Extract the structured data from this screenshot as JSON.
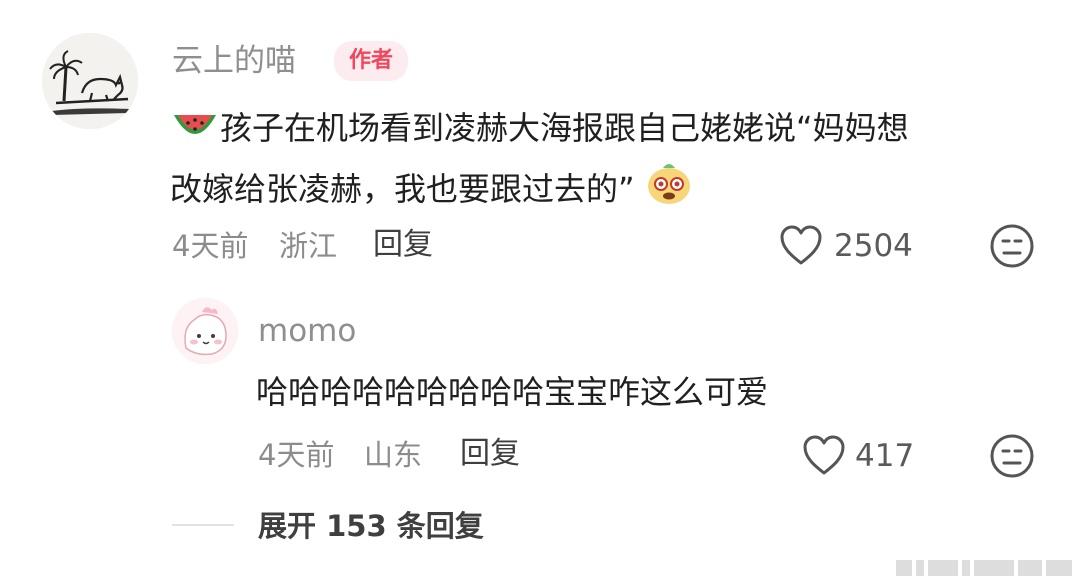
{
  "comment": {
    "username": "云上的喵",
    "author_badge": "作者",
    "text_line1": "孩子在机场看到凌赫大海报跟自己姥姥说“妈妈想",
    "text_line2": "改嫁给张凌赫，我也要跟过去的”",
    "time": "4天前",
    "location": "浙江",
    "reply_label": "回复",
    "like_count": "2504",
    "leading_emoji": "watermelon-icon",
    "trailing_emoji": "cute-face-sticker-icon"
  },
  "reply": {
    "username": "momo",
    "text": "哈哈哈哈哈哈哈哈哈宝宝咋这么可爱",
    "time": "4天前",
    "location": "山东",
    "reply_label": "回复",
    "like_count": "417"
  },
  "expand": {
    "label": "展开 153 条回复"
  },
  "colors": {
    "badge_bg": "#fdecef",
    "badge_text": "#f1475d",
    "meta_text": "#8c8c8c",
    "body_text": "#202020"
  }
}
